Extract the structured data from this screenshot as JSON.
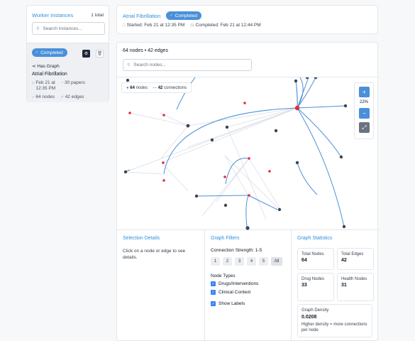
{
  "sidebar": {
    "title": "Worker Instances",
    "count": "1 total",
    "search_placeholder": "Search instances...",
    "card": {
      "status": "Completed",
      "has_graph": "Has Graph",
      "name": "Atrial Fibrillation",
      "date": "Feb 21 at 12:35 PM",
      "papers": "30 papers",
      "nodes": "64 nodes",
      "edges": "42 edges",
      "icons": [
        "settings-icon",
        "delete-icon"
      ]
    }
  },
  "header": {
    "title": "Atrial Fibrillation",
    "status": "Completed",
    "started": "Started: Feb 21 at 12:35 PM",
    "completed": "Completed: Feb 21 at 12:44 PM"
  },
  "graph": {
    "summary": "64 nodes • 42 edges",
    "search_placeholder": "Search nodes...",
    "legend": {
      "nodes_count": "64",
      "nodes_label": "nodes",
      "conn_count": "42",
      "conn_label": "connections"
    },
    "zoom": {
      "plus": "+",
      "level": "22%",
      "minus": "−",
      "reset": "⤢"
    },
    "colors": {
      "node_red": "#e0303a",
      "node_dark": "#3b4452",
      "edge_blue": "#4a90d9",
      "edge_faint": "#d5dbe2"
    }
  },
  "selection": {
    "title": "Selection Details",
    "text": "Click on a node or edge to see details."
  },
  "filters": {
    "title": "Graph Filters",
    "strength_label": "Connection Strength: 1-5",
    "strength_options": [
      "1",
      "2",
      "3",
      "4",
      "5",
      "All"
    ],
    "node_types_label": "Node Types",
    "types": [
      "Drugs/Interventions",
      "Clinical Context"
    ],
    "show_labels": "Show Labels"
  },
  "stats": {
    "title": "Graph Statistics",
    "total_nodes_label": "Total Nodes",
    "total_nodes": "64",
    "total_edges_label": "Total Edges",
    "total_edges": "42",
    "drug_nodes_label": "Drug Nodes",
    "drug_nodes": "33",
    "health_nodes_label": "Health Nodes",
    "health_nodes": "31",
    "density_label": "Graph Density",
    "density": "0.0208",
    "density_note": "Higher density = more connections per node"
  }
}
